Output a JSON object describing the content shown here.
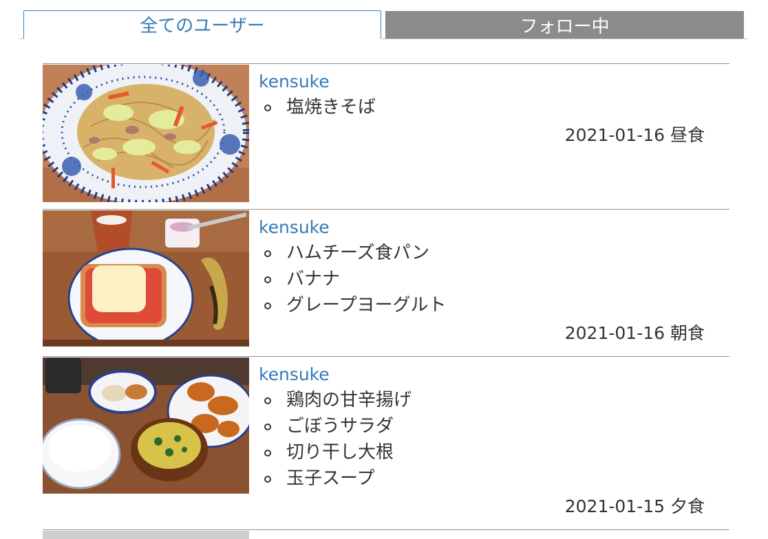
{
  "tabs": {
    "all_users": "全てのユーザー",
    "following": "フォロー中"
  },
  "posts": [
    {
      "user": "kensuke",
      "dishes": [
        "塩焼きそば"
      ],
      "date": "2021-01-16",
      "meal": "昼食"
    },
    {
      "user": "kensuke",
      "dishes": [
        "ハムチーズ食パン",
        "バナナ",
        "グレープヨーグルト"
      ],
      "date": "2021-01-16",
      "meal": "朝食"
    },
    {
      "user": "kensuke",
      "dishes": [
        "鶏肉の甘辛揚げ",
        "ごぼうサラダ",
        "切り干し大根",
        "玉子スープ"
      ],
      "date": "2021-01-15",
      "meal": "夕食"
    }
  ],
  "colors": {
    "link": "#337ab7",
    "inactive_tab": "#8b8b8b",
    "divider": "#8f8f8f"
  }
}
